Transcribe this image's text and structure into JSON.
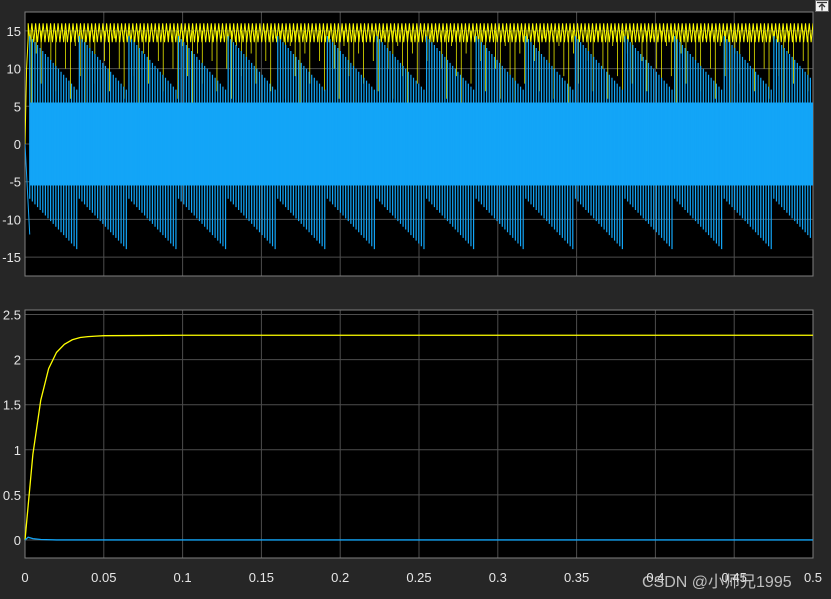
{
  "window": {
    "watermark": "CSDN @小师兄1995",
    "toolbar_icon": "undock-arrow-icon"
  },
  "colors": {
    "background": "#262626",
    "axes_bg": "#000000",
    "grid": "#4d4d4d",
    "axis_text": "#e6e6e6",
    "series1": "#FFFF00",
    "series2": "#13A5F7"
  },
  "chart_data": [
    {
      "type": "line",
      "title": "",
      "xlabel": "",
      "ylabel": "",
      "xlim": [
        0,
        0.5
      ],
      "ylim": [
        -17.5,
        17.5
      ],
      "x_ticks": [
        0,
        0.05,
        0.1,
        0.15,
        0.2,
        0.25,
        0.3,
        0.35,
        0.4,
        0.45,
        0.5
      ],
      "y_ticks": [
        -15,
        -10,
        -5,
        0,
        5,
        10,
        15
      ],
      "y_tick_labels": [
        "-15",
        "-10",
        "-5",
        "0",
        "5",
        "10",
        "15"
      ],
      "grid": true,
      "legend": "none",
      "series": [
        {
          "color": "#FFFF00",
          "description": "high-frequency switching, envelope",
          "startup_x": [
            0,
            0.001,
            0.002
          ],
          "startup_y": [
            0,
            10,
            14
          ],
          "upper_value": 16,
          "lower_value": 13.5,
          "mean_value": 15
        },
        {
          "color": "#13A5F7",
          "description": "high-frequency switching, envelope",
          "upper_value": 14.3,
          "lower_value": -14.3,
          "solid_band": [
            -5.5,
            5.5
          ]
        }
      ]
    },
    {
      "type": "line",
      "title": "",
      "xlabel": "",
      "ylabel": "",
      "xlim": [
        0,
        0.5
      ],
      "ylim": [
        -0.2,
        2.55
      ],
      "x_ticks": [
        0,
        0.05,
        0.1,
        0.15,
        0.2,
        0.25,
        0.3,
        0.35,
        0.4,
        0.45,
        0.5
      ],
      "x_tick_labels": [
        "0",
        "0.05",
        "0.1",
        "0.15",
        "0.2",
        "0.25",
        "0.3",
        "0.35",
        "0.4",
        "0.45",
        "0.5"
      ],
      "y_ticks": [
        0,
        0.5,
        1,
        1.5,
        2,
        2.5
      ],
      "y_tick_labels": [
        "0",
        "0.5",
        "1",
        "1.5",
        "2",
        "2.5"
      ],
      "grid": true,
      "legend": "none",
      "series": [
        {
          "color": "#FFFF00",
          "x": [
            0,
            0.005,
            0.01,
            0.015,
            0.02,
            0.025,
            0.03,
            0.035,
            0.04,
            0.045,
            0.05,
            0.1,
            0.2,
            0.3,
            0.4,
            0.5
          ],
          "y": [
            0,
            0.95,
            1.55,
            1.9,
            2.08,
            2.17,
            2.22,
            2.245,
            2.255,
            2.26,
            2.265,
            2.27,
            2.27,
            2.27,
            2.27,
            2.27
          ]
        },
        {
          "color": "#13A5F7",
          "x": [
            0,
            0.002,
            0.005,
            0.01,
            0.02,
            0.05,
            0.1,
            0.2,
            0.3,
            0.4,
            0.5
          ],
          "y": [
            0,
            0.03,
            0.015,
            0.005,
            0.0,
            0.0,
            0.0,
            0.0,
            0.0,
            0.0,
            0.0
          ]
        }
      ]
    }
  ]
}
